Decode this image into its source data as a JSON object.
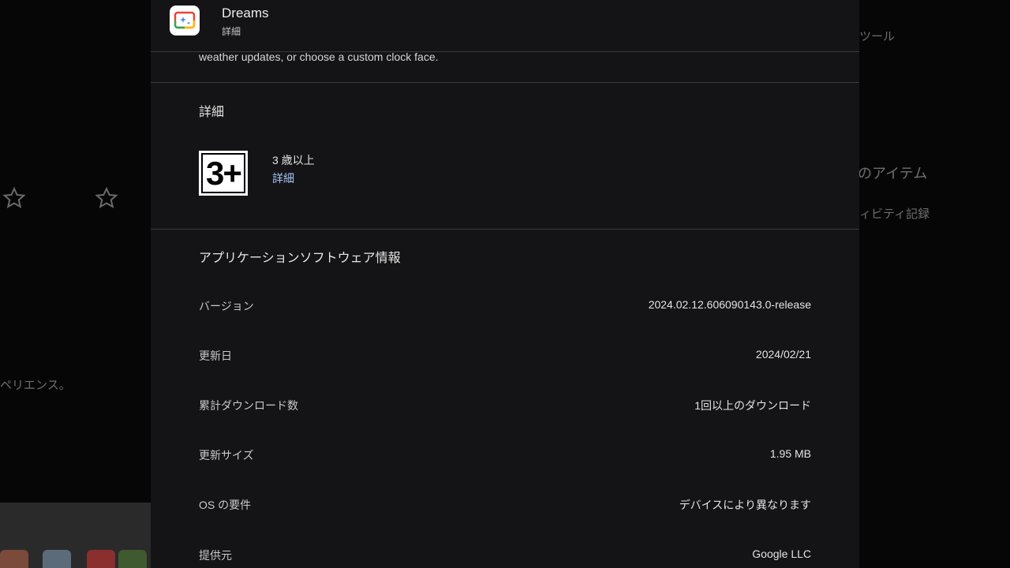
{
  "background": {
    "text_tool": "ツール",
    "text_items": "のアイテム",
    "text_activity": "ィビティ記録",
    "text_experience": "ペリエンス。"
  },
  "header": {
    "app_name": "Dreams",
    "subtitle": "詳細",
    "icon": "dreams-app-icon"
  },
  "description_tail": "weather updates, or choose a custom clock face.",
  "details": {
    "title": "詳細",
    "rating_badge": "3+",
    "rating_label": "3 歳以上",
    "rating_link": "詳細"
  },
  "software_info": {
    "title": "アプリケーションソフトウェア情報",
    "rows": [
      {
        "key": "バージョン",
        "value": "2024.02.12.606090143.0-release"
      },
      {
        "key": "更新日",
        "value": "2024/02/21"
      },
      {
        "key": "累計ダウンロード数",
        "value": "1回以上のダウンロード"
      },
      {
        "key": "更新サイズ",
        "value": "1.95 MB"
      },
      {
        "key": "OS の要件",
        "value": "デバイスにより異なります"
      },
      {
        "key": "提供元",
        "value": "Google LLC"
      }
    ]
  },
  "colors": {
    "dialog_bg": "#141416",
    "link": "#a8c7fa",
    "divider": "#3a3a3c"
  }
}
